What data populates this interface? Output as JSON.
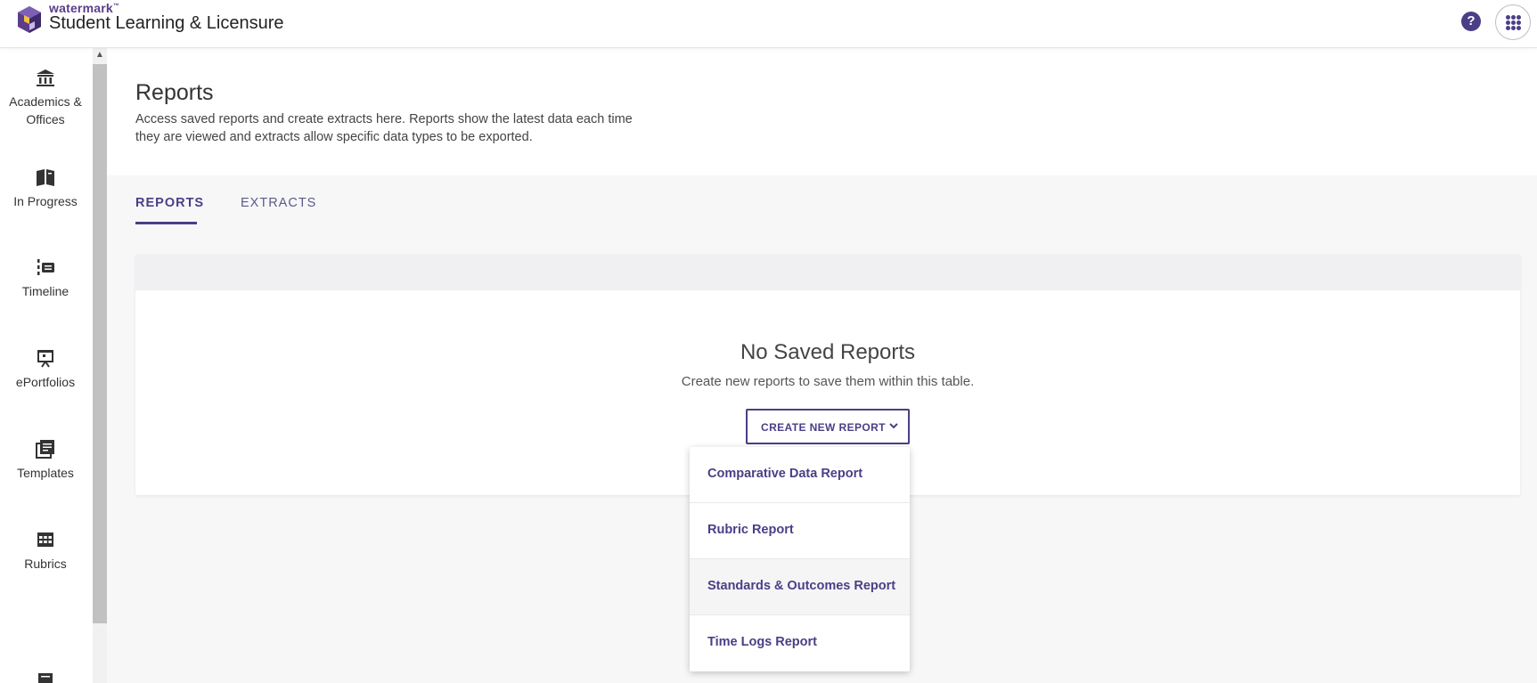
{
  "header": {
    "brand_small": "watermark",
    "brand_tm": "™",
    "brand_title": "Student Learning & Licensure",
    "help_icon": "question-circle-icon",
    "apps_icon": "app-grid-icon",
    "help_label": "?"
  },
  "sidebar": {
    "items": [
      {
        "label_line1": "Academics &",
        "label_line2": "Offices",
        "icon": "institution-icon"
      },
      {
        "label": "In Progress",
        "icon": "book-icon"
      },
      {
        "label": "Timeline",
        "icon": "timeline-icon"
      },
      {
        "label": "ePortfolios",
        "icon": "presentation-icon"
      },
      {
        "label": "Templates",
        "icon": "templates-icon"
      },
      {
        "label": "Rubrics",
        "icon": "table-icon"
      },
      {
        "label": "",
        "icon": "more-icon"
      }
    ],
    "scroll_up_glyph": "▲"
  },
  "page": {
    "title": "Reports",
    "description": "Access saved reports and create extracts here. Reports show the latest data each time they are viewed and extracts allow specific data types to be exported."
  },
  "tabs": [
    {
      "label": "REPORTS",
      "active": true
    },
    {
      "label": "EXTRACTS",
      "active": false
    }
  ],
  "empty_state": {
    "title": "No Saved Reports",
    "description": "Create new reports to save them within this table.",
    "button_label": "CREATE NEW REPORT"
  },
  "dropdown": {
    "items": [
      {
        "label": "Comparative Data Report"
      },
      {
        "label": "Rubric Report"
      },
      {
        "label": "Standards & Outcomes Report",
        "hovered": true
      },
      {
        "label": "Time Logs Report"
      }
    ]
  },
  "colors": {
    "accent": "#4a3f86",
    "brand": "#5b3d8a"
  }
}
